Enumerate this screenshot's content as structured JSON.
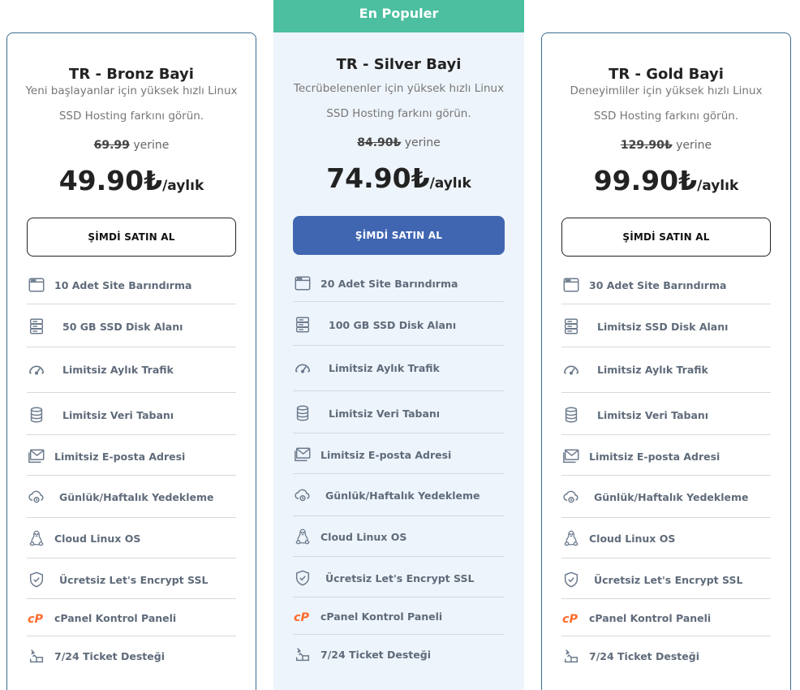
{
  "popular_banner": "En Populer",
  "plans": [
    {
      "title": "TR - Bronz Bayi",
      "description": "Yeni başlayanlar için yüksek hızlı Linux SSD Hosting farkını görün.",
      "old_price": "69.99",
      "old_price_suffix": "yerine",
      "price": "49.90₺",
      "price_unit": "/aylık",
      "button": "ŞİMDİ SATIN AL",
      "features": [
        "10 Adet Site Barındırma",
        "50 GB SSD Disk Alanı",
        "Limitsiz Aylık Trafik",
        "Limitsiz Veri Tabanı",
        "Limitsiz E-posta Adresi",
        "Günlük/Haftalık Yedekleme",
        "Cloud Linux OS",
        "Ücretsiz Let's Encrypt SSL",
        "cPanel Kontrol Paneli",
        "7/24 Ticket Desteği"
      ]
    },
    {
      "title": "TR - Silver Bayi",
      "description": "Tecrübelenenler için yüksek hızlı Linux SSD Hosting farkını görün.",
      "old_price": "84.90₺",
      "old_price_suffix": "yerine",
      "price": "74.90₺",
      "price_unit": "/aylık",
      "button": "ŞİMDİ SATIN AL",
      "features": [
        "20 Adet Site Barındırma",
        "100 GB SSD Disk Alanı",
        "Limitsiz Aylık Trafik",
        "Limitsiz Veri Tabanı",
        "Limitsiz E-posta Adresi",
        "Günlük/Haftalık Yedekleme",
        "Cloud Linux OS",
        "Ücretsiz Let's Encrypt SSL",
        "cPanel Kontrol Paneli",
        "7/24 Ticket Desteği"
      ]
    },
    {
      "title": "TR - Gold Bayi",
      "description": "Deneyimliler için yüksek hızlı Linux SSD Hosting farkını görün.",
      "old_price": "129.90₺",
      "old_price_suffix": "yerine",
      "price": "99.90₺",
      "price_unit": "/aylık",
      "button": "ŞİMDİ SATIN AL",
      "features": [
        "30 Adet Site Barındırma",
        "Limitsiz SSD Disk Alanı",
        "Limitsiz Aylık Trafik",
        "Limitsiz Veri Tabanı",
        "Limitsiz E-posta Adresi",
        "Günlük/Haftalık Yedekleme",
        "Cloud Linux OS",
        "Ücretsiz Let's Encrypt SSL",
        "cPanel Kontrol Paneli",
        "7/24 Ticket Desteği"
      ]
    }
  ],
  "feature_icons": [
    "browser-window-icon",
    "server-disk-icon",
    "speedometer-icon",
    "database-icon",
    "envelope-icon",
    "cloud-backup-icon",
    "linux-penguin-icon",
    "shield-check-icon",
    "cpanel-logo-icon",
    "ticket-support-icon"
  ],
  "colors": {
    "banner": "#4bbf9f",
    "buy_filled": "#4066b2",
    "card_border": "#3b6e8f",
    "silver_bg": "#eef4fb",
    "icon": "#6b7a8c",
    "cpanel": "#ff6c2c"
  }
}
